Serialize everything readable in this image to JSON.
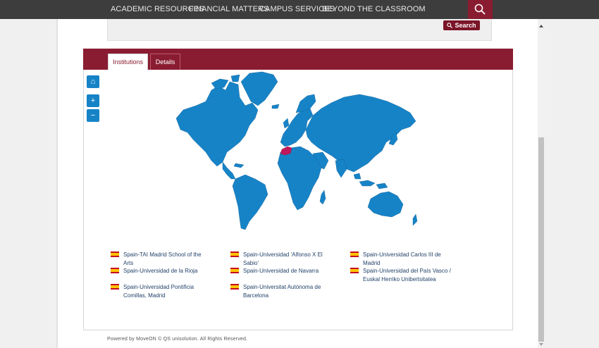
{
  "nav": {
    "items": [
      "ACADEMIC RESOURCES",
      "FINANCIAL MATTERS",
      "CAMPUS SERVICES",
      "BEYOND THE CLASSROOM"
    ],
    "search_icon": "magnifier-icon"
  },
  "search": {
    "button_label": "Search"
  },
  "tabs": [
    {
      "label": "Institutions",
      "active": true
    },
    {
      "label": "Details",
      "active": false
    }
  ],
  "map_controls": {
    "home": "⌂",
    "zoom_in": "+",
    "zoom_out": "−"
  },
  "institutions": [
    {
      "name": "Spain-TAI Madrid School of the Arts",
      "flag": "spain-flag-icon"
    },
    {
      "name": "Spain-Universidad 'Alfonso X El Sabio'",
      "flag": "spain-flag-icon"
    },
    {
      "name": "Spain-Universidad Carlos III de Madrid",
      "flag": "spain-flag-icon"
    },
    {
      "name": "Spain-Universidad de la Rioja",
      "flag": "spain-flag-icon"
    },
    {
      "name": "Spain-Universidad de Navarra",
      "flag": "spain-flag-icon"
    },
    {
      "name": "Spain-Universidad del País Vasco / Euskal Herriko Unibertsitatea",
      "flag": "spain-flag-icon"
    },
    {
      "name": "Spain-Universidad Pontificia Comillas, Madrid",
      "flag": "spain-flag-icon"
    },
    {
      "name": "Spain-Universitat Autónoma de Barcelona",
      "flag": "spain-flag-icon"
    }
  ],
  "footer": {
    "text": "Powered by MoveON © QS unisolution. All Rights Reserved."
  },
  "colors": {
    "brand": "#8a1c31",
    "map_land": "#1783c7",
    "highlight": "#c2185b",
    "nav_bg": "#3d3d3d"
  }
}
